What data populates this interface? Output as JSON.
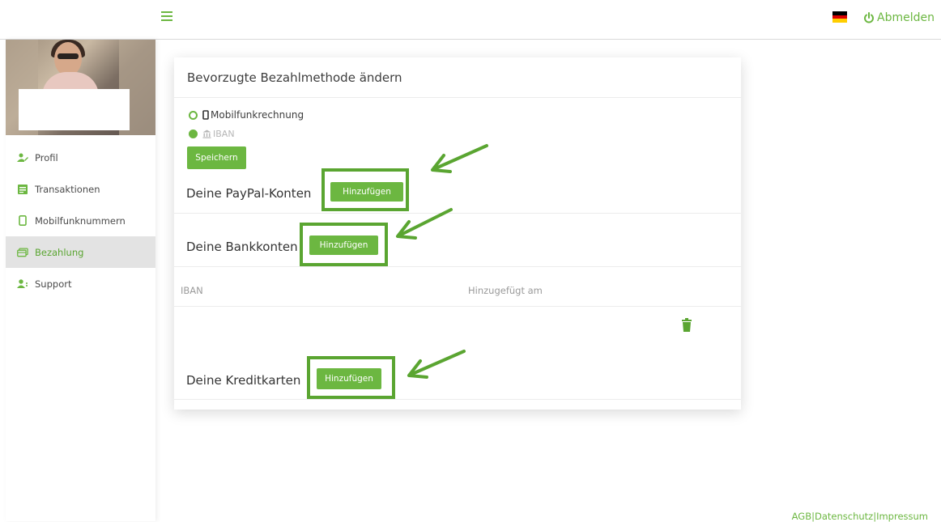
{
  "header": {
    "logout_label": "Abmelden",
    "icons": {
      "menu": "hamburger-icon",
      "flag": "german-flag",
      "power": "power-icon"
    }
  },
  "sidebar": {
    "items": [
      {
        "label": "Profil",
        "icon": "user-edit-icon"
      },
      {
        "label": "Transaktionen",
        "icon": "list-icon"
      },
      {
        "label": "Mobilfunknummern",
        "icon": "phone-icon"
      },
      {
        "label": "Bezahlung",
        "icon": "card-icon",
        "active": true
      },
      {
        "label": "Support",
        "icon": "support-icon"
      }
    ]
  },
  "payment": {
    "title": "Bevorzugte Bezahlmethode ändern",
    "options": [
      {
        "label": "Mobilfunkrechnung",
        "icon": "phone-icon",
        "selected": false
      },
      {
        "label": "IBAN",
        "icon": "bank-icon",
        "selected": true
      }
    ],
    "save_label": "Speichern"
  },
  "paypal": {
    "title": "Deine PayPal-Konten",
    "add_label": "Hinzufügen"
  },
  "bank": {
    "title": "Deine Bankkonten",
    "add_label": "Hinzufügen",
    "columns": [
      "IBAN",
      "Hinzugefügt am"
    ]
  },
  "cards": {
    "title": "Deine Kreditkarten",
    "add_label": "Hinzufügen"
  },
  "footer": {
    "agb": "AGB",
    "privacy": "Datenschutz",
    "imprint": "Impressum",
    "separator": "|"
  },
  "colors": {
    "accent": "#6cb741",
    "highlight": "#5aa531"
  }
}
